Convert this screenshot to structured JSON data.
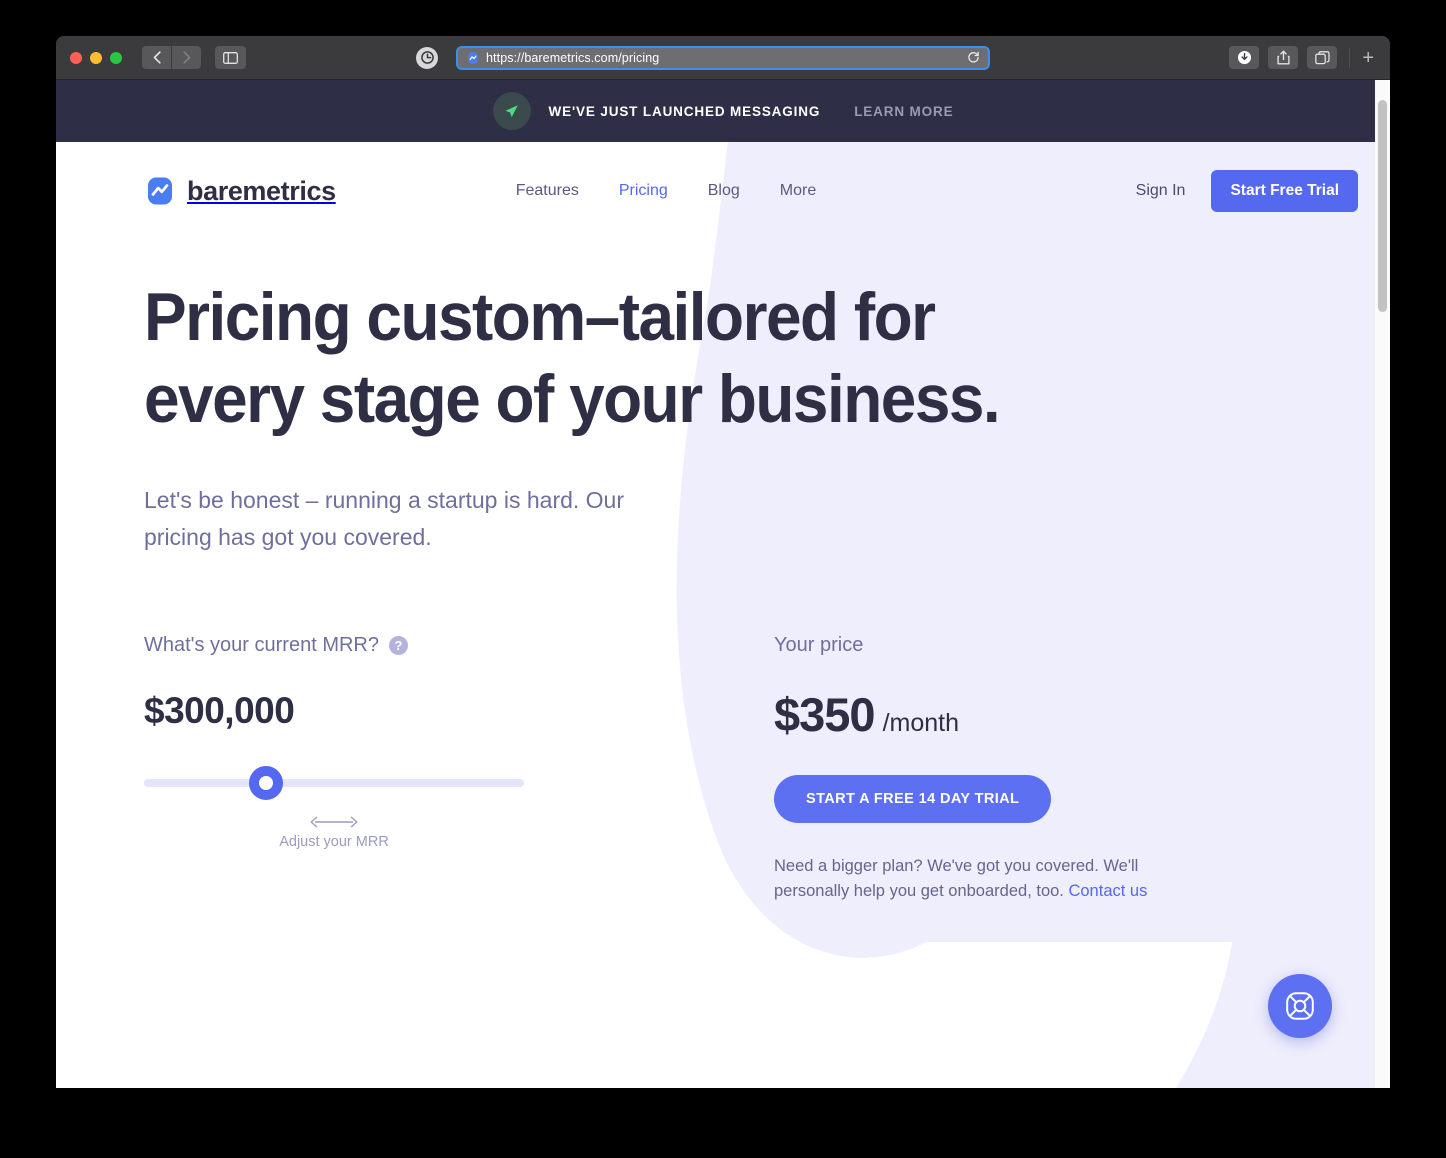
{
  "browser": {
    "url": "https://baremetrics.com/pricing",
    "traffic_lights": [
      "close",
      "minimize",
      "maximize"
    ],
    "back_icon": "chevron-left-icon",
    "forward_icon": "chevron-right-icon",
    "sidebar_icon": "sidebar-toggle-icon",
    "shield_icon": "reader-privacy-icon",
    "reload_icon": "reload-icon",
    "site_favicon": "baremetrics-favicon",
    "downloads_icon": "downloads-icon",
    "share_icon": "share-icon",
    "tabs_icon": "tab-overview-icon",
    "new_tab_label": "+"
  },
  "banner": {
    "icon": "paper-plane-icon",
    "text": "WE'VE JUST LAUNCHED MESSAGING",
    "learn_more": "LEARN MORE",
    "background": "#2e2e47",
    "icon_color": "#4ade80"
  },
  "header": {
    "logo_icon": "baremetrics-logo-icon",
    "brand": "baremetrics",
    "nav": [
      {
        "label": "Features",
        "active": false
      },
      {
        "label": "Pricing",
        "active": true
      },
      {
        "label": "Blog",
        "active": false
      },
      {
        "label": "More",
        "active": false
      }
    ],
    "sign_in": "Sign In",
    "start_free_trial": "Start Free Trial"
  },
  "hero": {
    "title": "Pricing custom–tailored for every stage of your business.",
    "subtitle": "Let's be honest – running a startup is hard. Our pricing has got you covered."
  },
  "calculator": {
    "mrr_label": "What's your current MRR?",
    "mrr_help_icon": "question-mark-icon",
    "mrr_help_glyph": "?",
    "mrr_value": "$300,000",
    "slider": {
      "thumb_position_percent": 31,
      "hint_icon": "left-right-arrow-icon",
      "hint_label": "Adjust your MRR"
    },
    "price_label": "Your price",
    "price_amount": "$350",
    "price_period": "/month",
    "cta_label": "START A FREE 14 DAY TRIAL",
    "note_text": "Need a bigger plan? We've got you covered. We'll personally help you get onboarded, too. ",
    "note_link": "Contact us"
  },
  "support": {
    "icon": "life-ring-icon"
  },
  "colors": {
    "accent_blue": "#5468f0",
    "cta_blue": "#5d70f2",
    "dark_navy": "#2e2e45",
    "muted_purple": "#6f6f9c",
    "blob_lavender": "#eeeefc",
    "banner_bg": "#2e2e47"
  }
}
